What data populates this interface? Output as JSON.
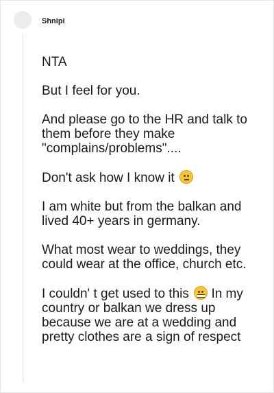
{
  "comment": {
    "author": "Shnipi",
    "paragraphs": [
      "NTA",
      "But I feel for you.",
      "And please go to the HR and talk to them before they make \"complains/problems\"....",
      "Don't ask how I know it",
      "I am white but from the balkan and lived 40+ years in germany.",
      "What most wear to weddings, they could wear at the office, church etc.",
      "I couldn' t get used to this",
      "In my country or balkan we dress up because we are at a wedding and pretty clothes are a sign of respect"
    ]
  },
  "icons": {
    "avatar": "avatar",
    "emoji_1": "eye-roll-emoji-icon",
    "emoji_2": "zipper-mouth-emoji-icon"
  }
}
